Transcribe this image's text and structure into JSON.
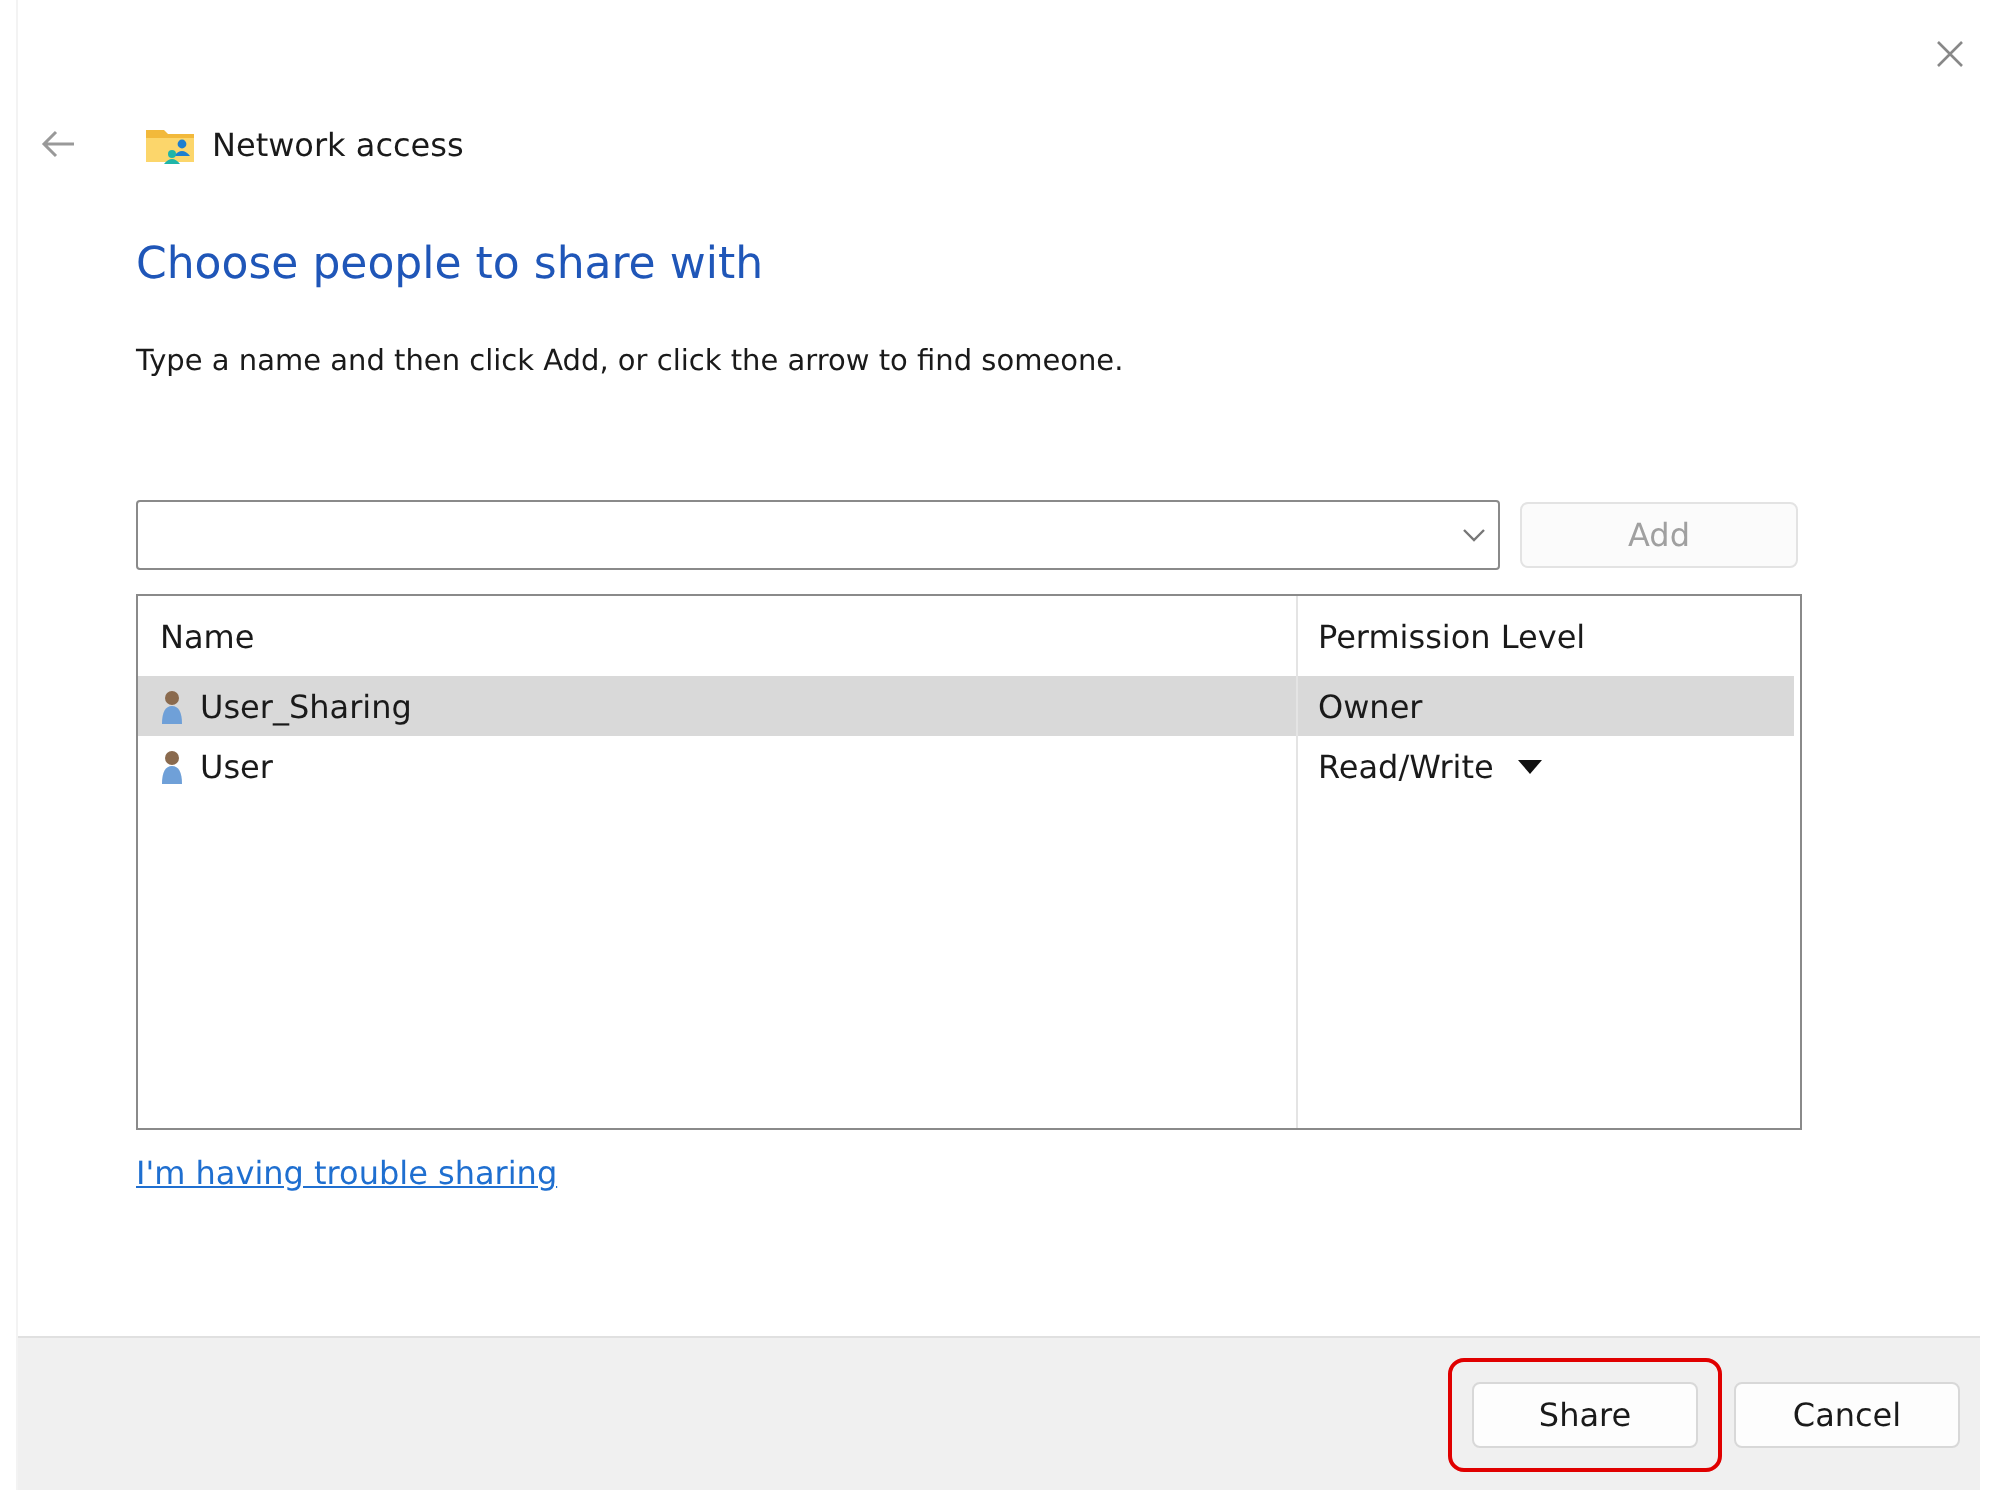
{
  "window": {
    "title": "Network access"
  },
  "heading": "Choose people to share with",
  "instruction": "Type a name and then click Add, or click the arrow to find someone.",
  "add_button": {
    "label": "Add",
    "disabled": true
  },
  "table": {
    "columns": [
      "Name",
      "Permission Level"
    ],
    "rows": [
      {
        "name": "User_Sharing",
        "permission": "Owner",
        "selected": true,
        "has_dropdown": false
      },
      {
        "name": "User",
        "permission": "Read/Write",
        "selected": false,
        "has_dropdown": true
      }
    ]
  },
  "help_link": "I'm having trouble sharing",
  "buttons": [
    {
      "label": "Share",
      "highlighted": true
    },
    {
      "label": "Cancel",
      "highlighted": false
    }
  ]
}
